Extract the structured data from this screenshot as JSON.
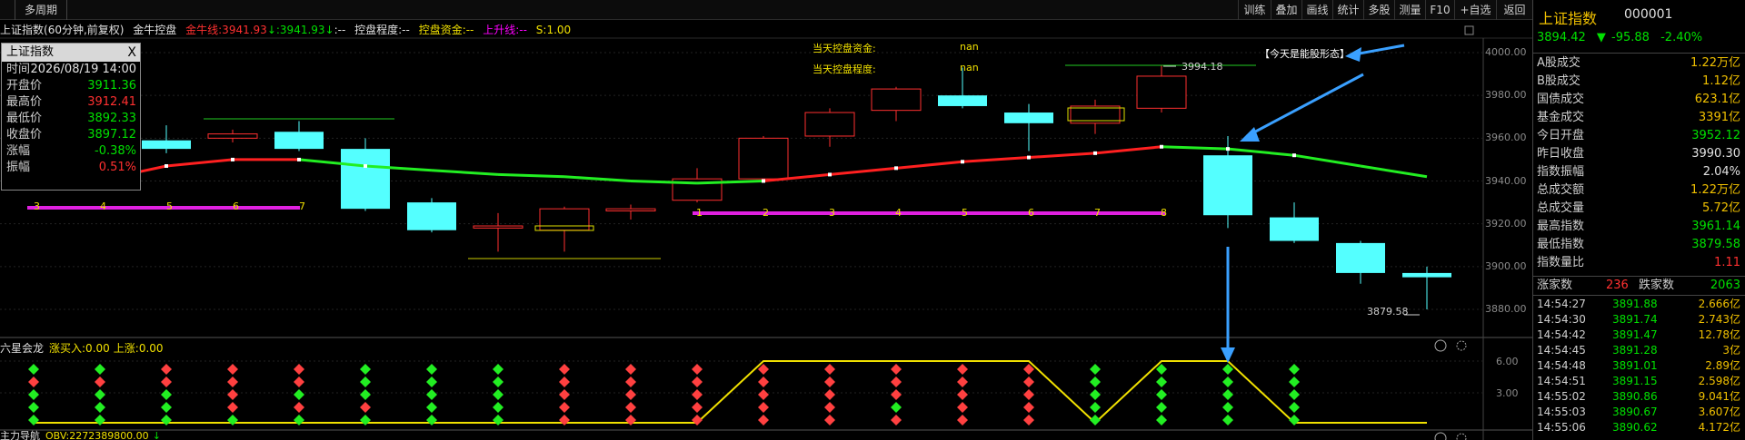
{
  "topbar": {
    "tab": "多周期",
    "buttons": [
      "训练",
      "叠加",
      "画线",
      "统计",
      "多股",
      "测量",
      "F10",
      "+自选",
      "返回"
    ]
  },
  "chart_info": {
    "name": "上证指数",
    "period": "(60分钟,前复权)",
    "indicator": "金牛控盘",
    "gold_line": "金牛线:3941.93",
    "down1": "↓",
    "val2": ":3941.93",
    "down2": "↓",
    "dashes": ":--",
    "control_degree": "控盘程度:--",
    "control_fund": "控盘资金:--",
    "rise_line": "上升线:--",
    "s_val": "S:1.00"
  },
  "annotations": {
    "fund_label": "当天控盘资金:",
    "fund_value": "nan",
    "degree_label": "当天控盘程度:",
    "degree_value": "nan",
    "callout": "【今天是能股形态】",
    "high_label": "3994.18",
    "low_label": "3879.58"
  },
  "tooltip": {
    "title": "上证指数",
    "close": "X",
    "rows": [
      {
        "label": "时间",
        "value": "2026/08/19 14:00",
        "color": "#e0e0e0"
      },
      {
        "label": "开盘价",
        "value": "3911.36",
        "color": "#00e000"
      },
      {
        "label": "最高价",
        "value": "3912.41",
        "color": "#ff3030"
      },
      {
        "label": "最低价",
        "value": "3892.33",
        "color": "#00e000"
      },
      {
        "label": "收盘价",
        "value": "3897.12",
        "color": "#00e000"
      },
      {
        "label": "涨幅",
        "value": "-0.38%",
        "color": "#00e000"
      },
      {
        "label": "振幅",
        "value": "0.51%",
        "color": "#ff3030"
      }
    ]
  },
  "y_axis": [
    "4000.00",
    "3980.00",
    "3960.00",
    "3940.00",
    "3920.00",
    "3900.00",
    "3880.00"
  ],
  "sub_axis": [
    "6.00",
    "3.00"
  ],
  "sub_panel": {
    "name": "六星会龙",
    "buy": "涨买入:0.00",
    "rise": "上涨:0.00"
  },
  "bottom_panel": {
    "name": "主力导航",
    "obv": "OBV:2272389800.00",
    "arrow": "↓"
  },
  "purple_labels_1": [
    "3",
    "4",
    "5",
    "6",
    "7"
  ],
  "purple_labels_2": [
    "1",
    "2",
    "3",
    "4",
    "5",
    "6",
    "7",
    "8"
  ],
  "right_panel": {
    "title": "上证指数",
    "code": "000001",
    "price": "3894.42",
    "arrow": "▼",
    "change": "-95.88",
    "pct": "-2.40%",
    "rows": [
      {
        "label": "A股成交",
        "value": "1.22万亿",
        "color": "#f0c000"
      },
      {
        "label": "B股成交",
        "value": "1.12亿",
        "color": "#f0c000"
      },
      {
        "label": "国债成交",
        "value": "623.1亿",
        "color": "#f0c000"
      },
      {
        "label": "基金成交",
        "value": "3391亿",
        "color": "#f0c000"
      },
      {
        "label": "今日开盘",
        "value": "3952.12",
        "color": "#00e000"
      },
      {
        "label": "昨日收盘",
        "value": "3990.30",
        "color": "#e0e0e0"
      },
      {
        "label": "指数振幅",
        "value": "2.04%",
        "color": "#e0e0e0"
      },
      {
        "label": "总成交额",
        "value": "1.22万亿",
        "color": "#f0c000"
      },
      {
        "label": "总成交量",
        "value": "5.72亿",
        "color": "#f0c000"
      },
      {
        "label": "最高指数",
        "value": "3961.14",
        "color": "#00e000"
      },
      {
        "label": "最低指数",
        "value": "3879.58",
        "color": "#00e000"
      },
      {
        "label": "指数量比",
        "value": "1.11",
        "color": "#ff3030"
      }
    ],
    "up_label": "涨家数",
    "up_value": "236",
    "down_label": "跌家数",
    "down_value": "2063",
    "ticks": [
      {
        "time": "14:54:27",
        "price": "3891.88",
        "vol": "2.666亿"
      },
      {
        "time": "14:54:30",
        "price": "3891.74",
        "vol": "2.743亿"
      },
      {
        "time": "14:54:42",
        "price": "3891.47",
        "vol": "12.78亿"
      },
      {
        "time": "14:54:45",
        "price": "3891.28",
        "vol": "3亿"
      },
      {
        "time": "14:54:48",
        "price": "3891.01",
        "vol": "2.89亿"
      },
      {
        "time": "14:54:51",
        "price": "3891.15",
        "vol": "2.598亿"
      },
      {
        "time": "14:55:02",
        "price": "3890.86",
        "vol": "9.041亿"
      },
      {
        "time": "14:55:03",
        "price": "3890.67",
        "vol": "3.607亿"
      },
      {
        "time": "14:55:06",
        "price": "3890.62",
        "vol": "4.172亿"
      }
    ]
  },
  "chart_data": {
    "type": "candlestick",
    "y_range": [
      3870,
      4004
    ],
    "candles": [
      {
        "o": 3959,
        "h": 3966,
        "l": 3953,
        "c": 3955,
        "up": false
      },
      {
        "o": 3962,
        "h": 3964,
        "l": 3958,
        "c": 3960,
        "up": true
      },
      {
        "o": 3963,
        "h": 3968,
        "l": 3954,
        "c": 3955,
        "up": false
      },
      {
        "o": 3955,
        "h": 3960,
        "l": 3926,
        "c": 3927,
        "up": false
      },
      {
        "o": 3930,
        "h": 3932,
        "l": 3916,
        "c": 3917,
        "up": false
      },
      {
        "o": 3918,
        "h": 3925,
        "l": 3907,
        "c": 3919,
        "up": true
      },
      {
        "o": 3917,
        "h": 3928,
        "l": 3907,
        "c": 3927,
        "up": true
      },
      {
        "o": 3926,
        "h": 3929,
        "l": 3922,
        "c": 3927,
        "up": true
      },
      {
        "o": 3931,
        "h": 3946,
        "l": 3930,
        "c": 3941,
        "up": true
      },
      {
        "o": 3941,
        "h": 3961,
        "l": 3941,
        "c": 3960,
        "up": true
      },
      {
        "o": 3961,
        "h": 3974,
        "l": 3956,
        "c": 3972,
        "up": true
      },
      {
        "o": 3973,
        "h": 3984,
        "l": 3968,
        "c": 3983,
        "up": true
      },
      {
        "o": 3980,
        "h": 3993,
        "l": 3974,
        "c": 3975,
        "up": false
      },
      {
        "o": 3972,
        "h": 3976,
        "l": 3954,
        "c": 3967,
        "up": false
      },
      {
        "o": 3967,
        "h": 3978,
        "l": 3962,
        "c": 3975,
        "up": true
      },
      {
        "o": 3974,
        "h": 3994,
        "l": 3972,
        "c": 3989,
        "up": true
      },
      {
        "o": 3952,
        "h": 3961,
        "l": 3918,
        "c": 3924,
        "up": false
      },
      {
        "o": 3923,
        "h": 3930,
        "l": 3911,
        "c": 3912,
        "up": false
      },
      {
        "o": 3911,
        "h": 3912,
        "l": 3892,
        "c": 3897,
        "up": false
      },
      {
        "o": 3897,
        "h": 3900,
        "l": 3880,
        "c": 3895,
        "up": false
      }
    ],
    "ma": [
      3944,
      3947,
      3950,
      3950,
      3947,
      3945,
      3943,
      3942,
      3940,
      3939,
      3940,
      3943,
      3946,
      3949,
      3951,
      3953,
      3956,
      3955,
      3952,
      3947,
      3942
    ],
    "ma_down_from": 16
  },
  "sub_chart": {
    "y_range": [
      0,
      6.5
    ],
    "yellow_line": [
      0,
      0,
      0,
      0,
      0,
      0,
      0,
      0,
      0,
      0,
      0,
      6,
      6,
      6,
      6,
      6,
      0,
      6,
      6,
      0,
      0,
      0,
      0
    ],
    "diamond_colors": [
      [
        "g",
        "r",
        "g",
        "g",
        "g"
      ],
      [
        "g",
        "r",
        "g",
        "g",
        "g"
      ],
      [
        "r",
        "r",
        "g",
        "g",
        "g"
      ],
      [
        "r",
        "r",
        "r",
        "r",
        "g"
      ],
      [
        "r",
        "r",
        "g",
        "r",
        "g"
      ],
      [
        "g",
        "g",
        "g",
        "r",
        "g"
      ],
      [
        "g",
        "g",
        "g",
        "g",
        "g"
      ],
      [
        "g",
        "g",
        "g",
        "g",
        "g"
      ],
      [
        "r",
        "r",
        "r",
        "r",
        "r"
      ],
      [
        "r",
        "r",
        "r",
        "r",
        "r"
      ],
      [
        "r",
        "r",
        "r",
        "r",
        "r"
      ],
      [
        "r",
        "r",
        "r",
        "r",
        "r"
      ],
      [
        "r",
        "r",
        "r",
        "r",
        "r"
      ],
      [
        "r",
        "r",
        "r",
        "g",
        "r"
      ],
      [
        "r",
        "r",
        "r",
        "r",
        "r"
      ],
      [
        "r",
        "r",
        "r",
        "r",
        "r"
      ],
      [
        "g",
        "g",
        "g",
        "g",
        "g"
      ],
      [
        "g",
        "g",
        "g",
        "g",
        "g"
      ],
      [
        "g",
        "g",
        "g",
        "g",
        "g"
      ],
      [
        "g",
        "g",
        "g",
        "g",
        "g"
      ]
    ]
  }
}
